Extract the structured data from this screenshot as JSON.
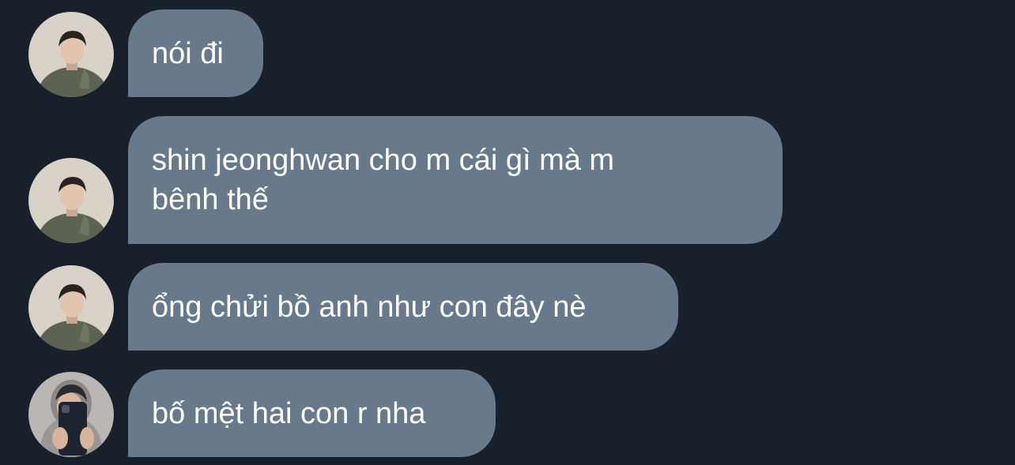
{
  "messages": [
    {
      "text": "nói đi",
      "avatar": "user-a"
    },
    {
      "text": "shin jeonghwan cho m cái gì mà m\nbênh thế",
      "avatar": "user-a"
    },
    {
      "text": "ổng chửi bồ anh như con đây nè",
      "avatar": "user-a"
    },
    {
      "text": "bố mệt hai con r nha",
      "avatar": "user-b"
    }
  ],
  "colors": {
    "background": "#18202b",
    "bubble": "#67798a",
    "text": "#ffffff"
  }
}
